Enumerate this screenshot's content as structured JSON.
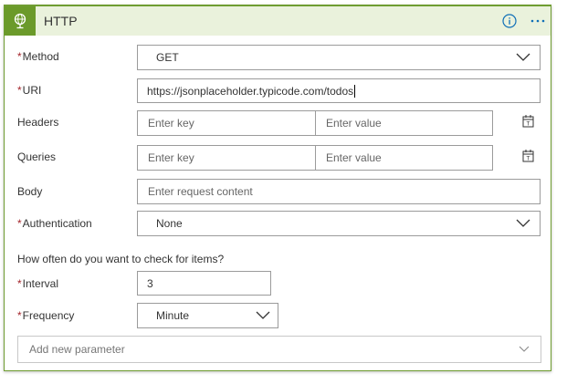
{
  "header": {
    "title": "HTTP",
    "icon": "globe-icon",
    "accent": "#6b9a2a",
    "header_bg": "#eaf2dc"
  },
  "fields": {
    "method": {
      "label": "Method",
      "value": "GET"
    },
    "uri": {
      "label": "URI",
      "value": "https://jsonplaceholder.typicode.com/todos"
    },
    "headers": {
      "label": "Headers",
      "key_placeholder": "Enter key",
      "value_placeholder": "Enter value"
    },
    "queries": {
      "label": "Queries",
      "key_placeholder": "Enter key",
      "value_placeholder": "Enter value"
    },
    "body": {
      "label": "Body",
      "placeholder": "Enter request content"
    },
    "authentication": {
      "label": "Authentication",
      "value": "None"
    },
    "question": "How often do you want to check for items?",
    "interval": {
      "label": "Interval",
      "value": "3"
    },
    "frequency": {
      "label": "Frequency",
      "value": "Minute"
    }
  },
  "add_parameter": {
    "placeholder": "Add new parameter"
  },
  "required_marker": "*"
}
